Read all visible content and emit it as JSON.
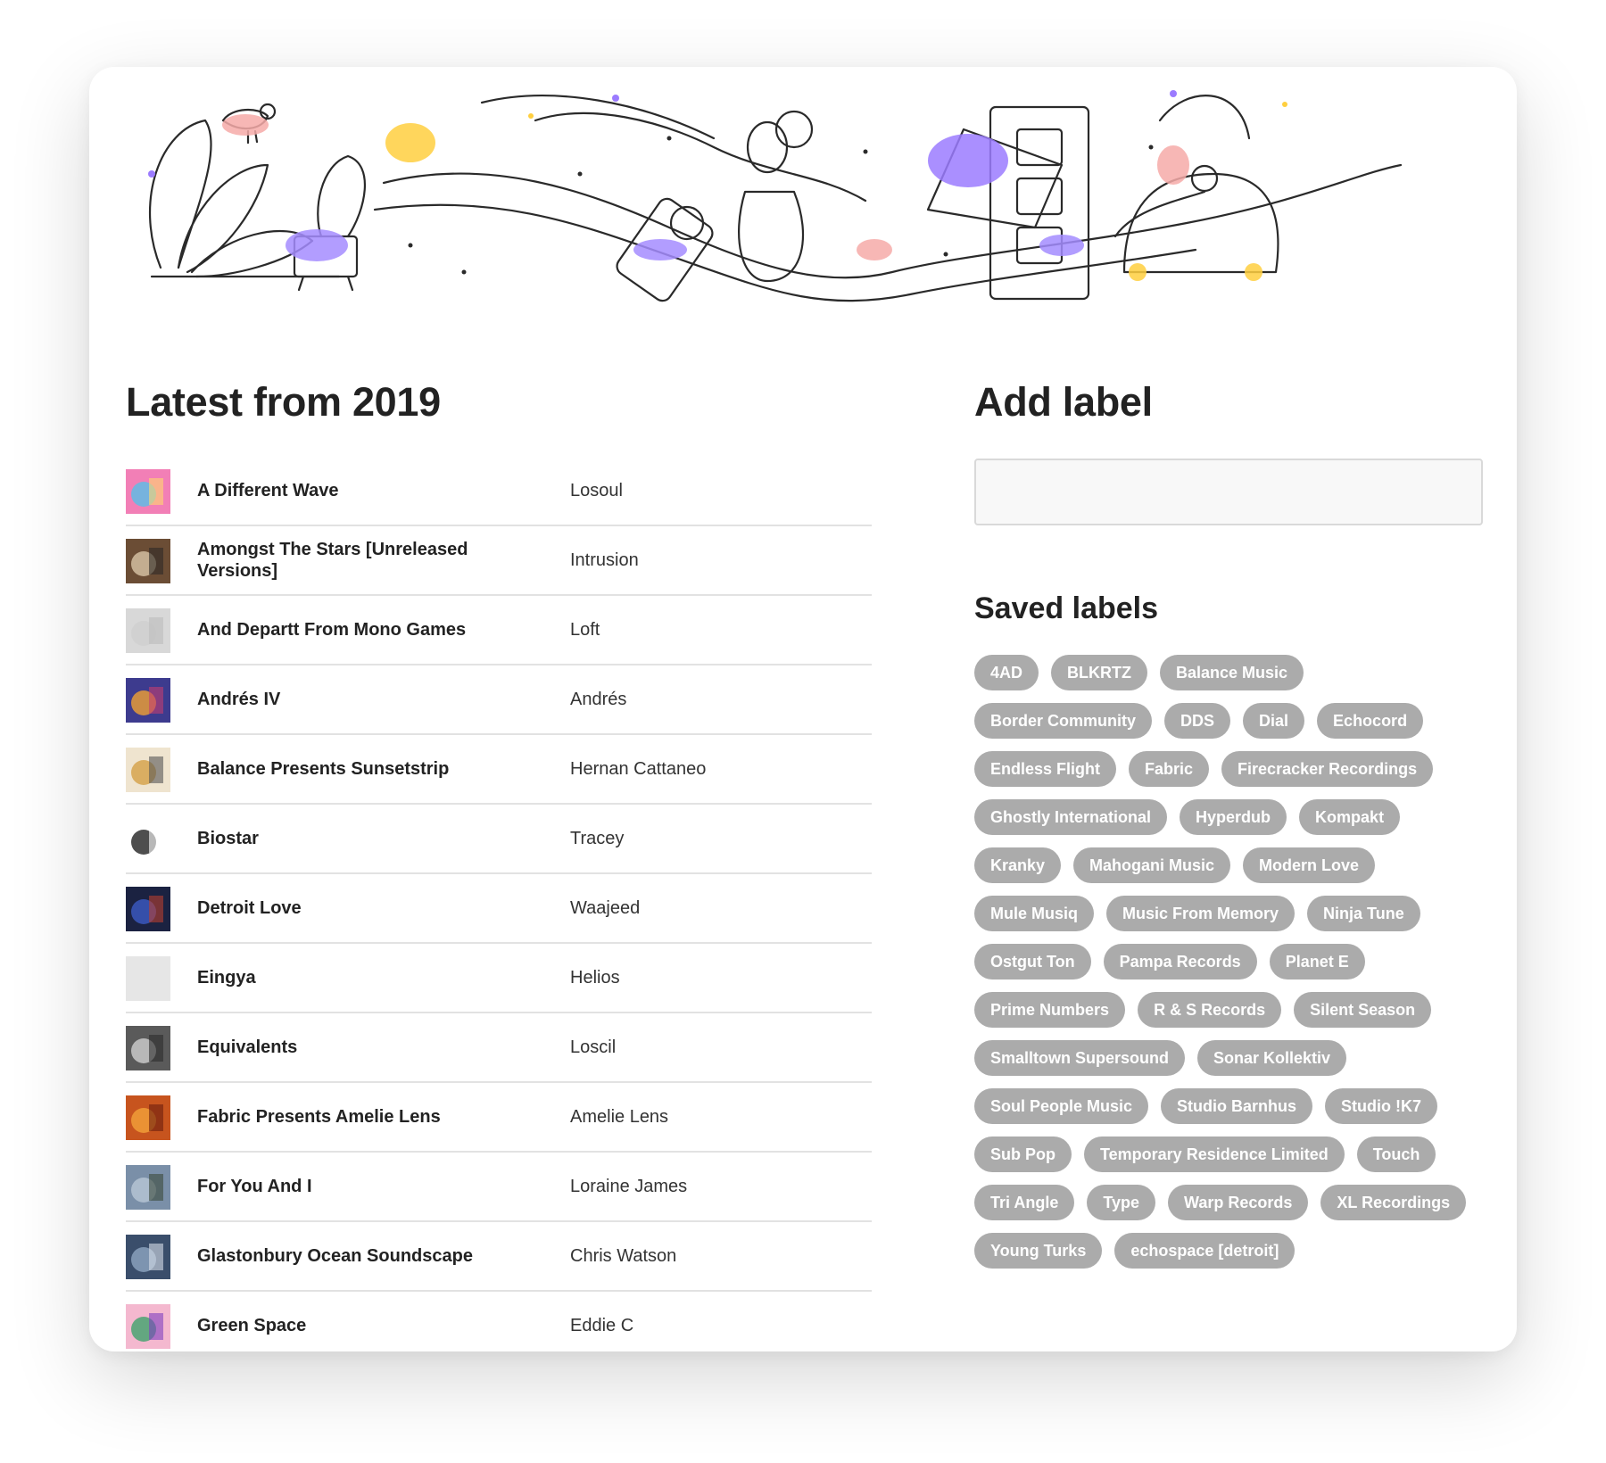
{
  "left": {
    "heading": "Latest from 2019",
    "releases": [
      {
        "title": "A Different Wave",
        "artist": "Losoul"
      },
      {
        "title": "Amongst The Stars [Unreleased Versions]",
        "artist": "Intrusion"
      },
      {
        "title": "And Departt From Mono Games",
        "artist": "Loft"
      },
      {
        "title": "Andrés IV",
        "artist": "Andrés"
      },
      {
        "title": "Balance Presents Sunsetstrip",
        "artist": "Hernan Cattaneo"
      },
      {
        "title": "Biostar",
        "artist": "Tracey"
      },
      {
        "title": "Detroit Love",
        "artist": "Waajeed"
      },
      {
        "title": "Eingya",
        "artist": "Helios"
      },
      {
        "title": "Equivalents",
        "artist": "Loscil"
      },
      {
        "title": "Fabric Presents Amelie Lens",
        "artist": "Amelie Lens"
      },
      {
        "title": "For You And I",
        "artist": "Loraine James"
      },
      {
        "title": "Glastonbury Ocean Soundscape",
        "artist": "Chris Watson"
      },
      {
        "title": "Green Space",
        "artist": "Eddie C"
      }
    ]
  },
  "right": {
    "add_heading": "Add label",
    "input_value": "",
    "saved_heading": "Saved labels",
    "labels": [
      "4AD",
      "BLKRTZ",
      "Balance Music",
      "Border Community",
      "DDS",
      "Dial",
      "Echocord",
      "Endless Flight",
      "Fabric",
      "Firecracker Recordings",
      "Ghostly International",
      "Hyperdub",
      "Kompakt",
      "Kranky",
      "Mahogani Music",
      "Modern Love",
      "Mule Musiq",
      "Music From Memory",
      "Ninja Tune",
      "Ostgut Ton",
      "Pampa Records",
      "Planet E",
      "Prime Numbers",
      "R & S Records",
      "Silent Season",
      "Smalltown Supersound",
      "Sonar Kollektiv",
      "Soul People Music",
      "Studio Barnhus",
      "Studio !K7",
      "Sub Pop",
      "Temporary Residence Limited",
      "Touch",
      "Tri Angle",
      "Type",
      "Warp Records",
      "XL Recordings",
      "Young Turks",
      "echospace [detroit]"
    ]
  },
  "colors": {
    "chip_bg": "#ababab",
    "accent_purple": "#9b7bff",
    "accent_pink": "#f6aaa8",
    "accent_yellow": "#ffcf3f"
  }
}
